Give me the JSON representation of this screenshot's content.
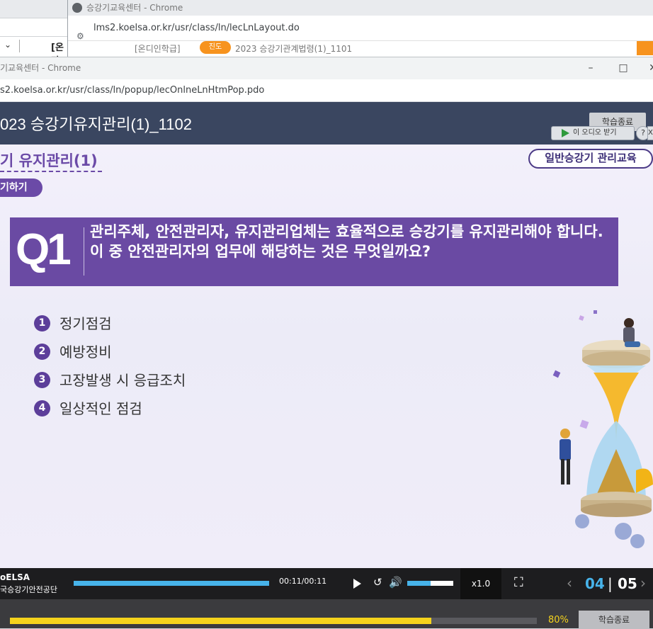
{
  "back_window": {
    "left_label": "[온라",
    "popup_title": "승강기교육센터 - Chrome",
    "popup_url": "lms2.koelsa.or.kr/usr/class/ln/lecLnLayout.do",
    "content_left": "[온디인학급]",
    "content_badge": "진도",
    "content_right": "2023 승강기관계법령(1)_1101"
  },
  "window": {
    "title": "기교육센터 - Chrome",
    "url": "s2.koelsa.or.kr/usr/class/ln/popup/lecOnlneLnHtmPop.pdo"
  },
  "header": {
    "course_title": "023 승강기유지관리(1)_1102",
    "finish_label": "학습종료",
    "audio_label": "이 오디오 받기",
    "help_label": "?",
    "close_label": "X"
  },
  "slide": {
    "section_title": "기 유지관리(1)",
    "step_label": "기하기",
    "category": "일반승강기 관리교육",
    "question_number": "Q1",
    "question_text": "관리주체, 안전관리자, 유지관리업체는 효율적으로 승강기를 유지관리해야 합니다. 이 중 안전관리자의 업무에 해당하는 것은 무엇일까요?",
    "options": [
      {
        "num": "1",
        "label": "정기점검"
      },
      {
        "num": "2",
        "label": "예방정비"
      },
      {
        "num": "3",
        "label": "고장발생 시 응급조치"
      },
      {
        "num": "4",
        "label": "일상적인 점검"
      }
    ]
  },
  "player": {
    "logo_top": "oELSA",
    "logo_bottom": "국승강기안전공단",
    "timecode": "00:11/00:11",
    "speed": "x1.0",
    "current_page": "04",
    "separator": "|",
    "total_pages": "05",
    "seek_fraction": 1.0,
    "volume_fraction": 0.5
  },
  "progress": {
    "percent_label": "80%",
    "fraction": 0.8,
    "finish_label": "학습종료"
  },
  "colors": {
    "header_bg": "#3a4660",
    "question_bg": "#6a4aa3",
    "accent_blue": "#47b3ea",
    "accent_yellow": "#f5d31c"
  }
}
